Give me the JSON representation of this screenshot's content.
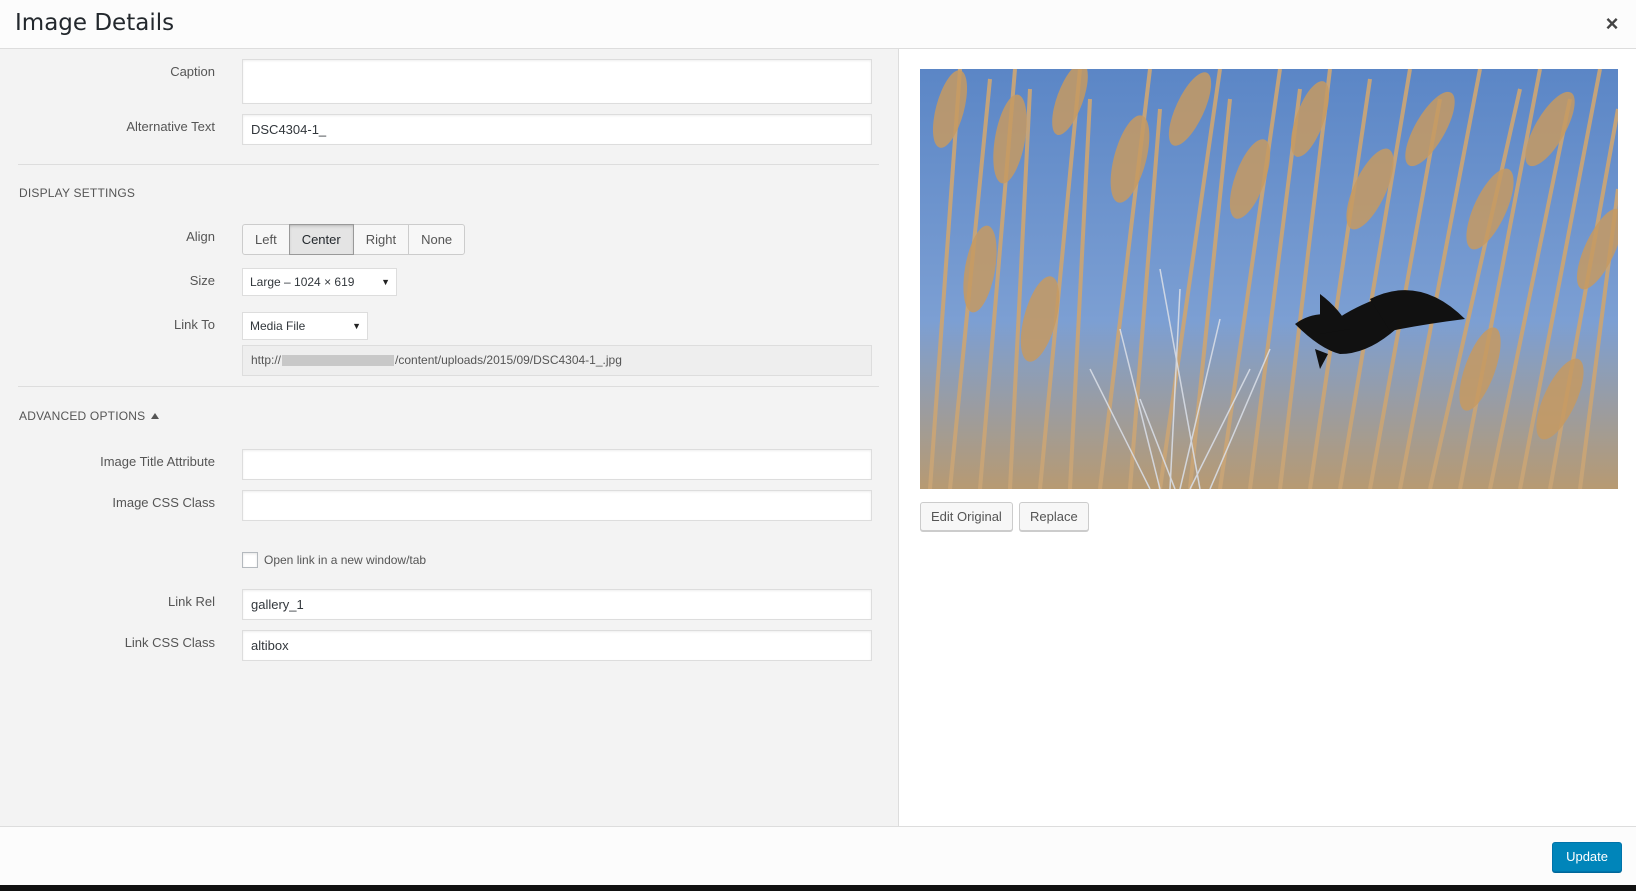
{
  "dialog": {
    "title": "Image Details",
    "close_icon": "close-icon",
    "close_glyph": "×"
  },
  "fields": {
    "caption_label": "Caption",
    "caption_value": "",
    "alt_label": "Alternative Text",
    "alt_value": "DSC4304-1_"
  },
  "display_settings": {
    "title": "DISPLAY SETTINGS",
    "align_label": "Align",
    "align_options": [
      "Left",
      "Center",
      "Right",
      "None"
    ],
    "align_selected": "Center",
    "size_label": "Size",
    "size_value": "Large – 1024 × 619",
    "link_to_label": "Link To",
    "link_to_value": "Media File",
    "url_prefix": "http://",
    "url_suffix": "/content/uploads/2015/09/DSC4304-1_.jpg",
    "dropdown_glyph": "▼"
  },
  "advanced": {
    "title": "ADVANCED OPTIONS",
    "toggle_icon": "caret-up-icon",
    "title_attr_label": "Image Title Attribute",
    "title_attr_value": "",
    "css_class_label": "Image CSS Class",
    "css_class_value": "",
    "new_window_label": "Open link in a new window/tab",
    "new_window_checked": false,
    "link_rel_label": "Link Rel",
    "link_rel_value": "gallery_1",
    "link_css_label": "Link CSS Class",
    "link_css_value": "altibox"
  },
  "preview": {
    "image_description": "reeds-bird-photo",
    "edit_label": "Edit Original",
    "replace_label": "Replace"
  },
  "footer": {
    "update_label": "Update"
  },
  "colors": {
    "primary": "#0085ba",
    "panel": "#f3f3f3"
  }
}
